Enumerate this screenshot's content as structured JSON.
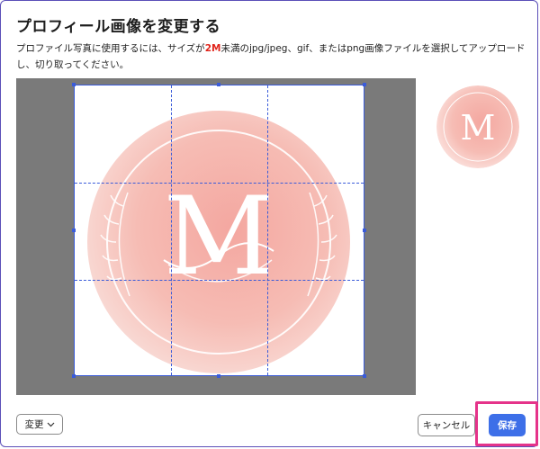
{
  "dialog": {
    "title": "プロフィール画像を変更する",
    "description_pre": "プロファイル写真に使用するには、サイズが",
    "description_em": "2M",
    "description_post": "未満のjpg/jpeg、gif、またはpng画像ファイルを選択してアップロードし、切り取ってください。"
  },
  "image": {
    "letter": "M"
  },
  "buttons": {
    "change_label": "変更",
    "cancel_label": "キャンセル",
    "save_label": "保存"
  },
  "colors": {
    "accent": "#3d6fe8",
    "guide": "#3a5bd9",
    "highlight": "#e5338a",
    "emphasis": "#e0241b",
    "overlay": "#7a7a7a"
  },
  "icons": {
    "change_dropdown": "chevron-down-icon"
  }
}
